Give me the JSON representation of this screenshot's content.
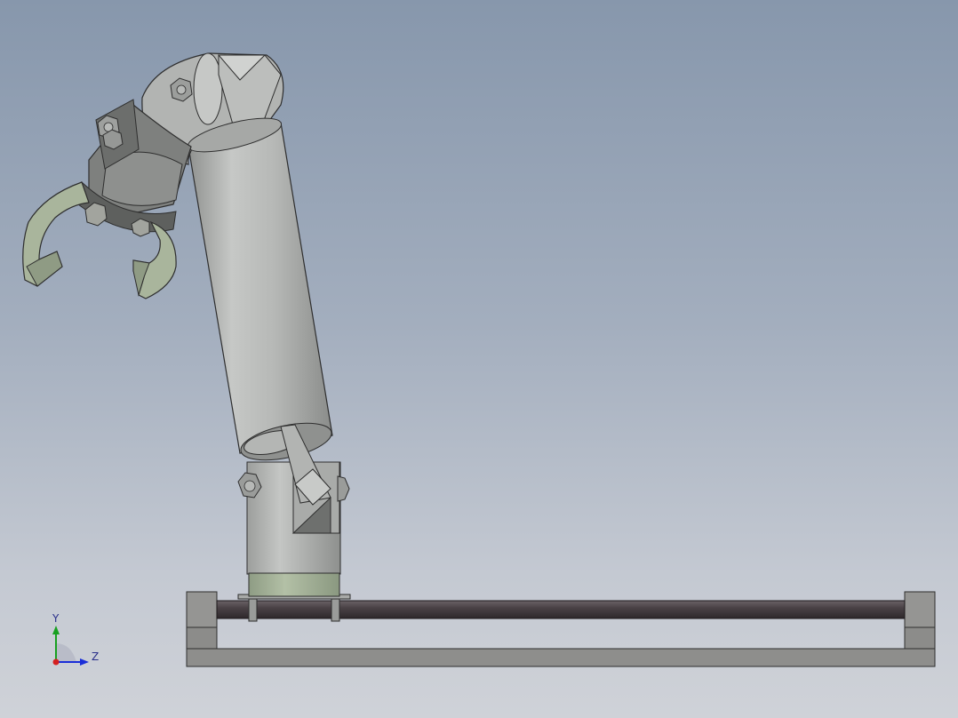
{
  "triad": {
    "y_label": "Y",
    "z_label": "Z",
    "x_color": "#d42020",
    "y_color": "#18a020",
    "z_color": "#1a2ed8"
  },
  "colors": {
    "background_top": "#8797ac",
    "background_bottom": "#cfd2d8",
    "arm_body": "#b8bab8",
    "arm_shadow": "#8a8c8a",
    "gripper": "#a8b49c",
    "base_ring": "#a7b59a",
    "rail": "#4a4246",
    "frame": "#8e8e8c",
    "edge": "#2e2e2e"
  },
  "parts": {
    "base": "base-frame",
    "rail": "guide-rail",
    "column": "base-column",
    "arm": "arm-tube",
    "elbow": "elbow-joint",
    "gripper": "gripper"
  }
}
